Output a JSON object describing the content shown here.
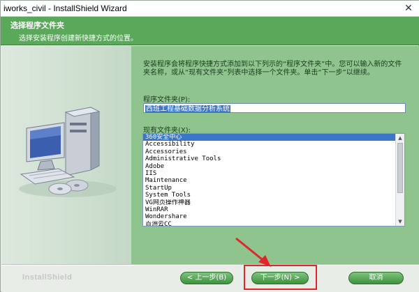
{
  "window": {
    "title": "iworks_civil - InstallShield Wizard",
    "close_glyph": "✕"
  },
  "header": {
    "title": "选择程序文件夹",
    "subtitle": "选择安装程序创建新快捷方式的位置。"
  },
  "main": {
    "intro": "安装程序会将程序快捷方式添加到以下列示的“程序文件夹”中。您可以输入新的文件夹名称，或从“现有文件夹”列表中选择一个文件夹。单击“下一步”以继续。",
    "program_folder_label": "程序文件夹(P):",
    "program_folder_value": "西班工程基础数据分析系统",
    "existing_folders_label": "现有文件夹(X):",
    "existing_folders": [
      "360安全中心",
      "Accessibility",
      "Accessories",
      "Administrative Tools",
      "Adobe",
      "IIS",
      "Maintenance",
      "StartUp",
      "System Tools",
      "VG网页操作神器",
      "WinRAR",
      "Wondershare",
      "百洲云CC"
    ],
    "selected_folder_index": 0
  },
  "footer": {
    "brand": "InstallShield",
    "back_label": "< 上一步(B)",
    "next_label": "下一步(N) >",
    "cancel_label": "取消"
  },
  "colors": {
    "header_bg": "#5aa95a",
    "panel_bg": "#8fc48f",
    "button_green": "#3f913f",
    "selection_blue": "#3b76c9",
    "annotation_red": "#e0262b"
  },
  "icons": {
    "close": "close-icon",
    "computer": "computer-illustration",
    "scroll_up": "scroll-up-icon",
    "scroll_down": "scroll-down-icon",
    "annotation_arrow": "red-arrow-annotation"
  }
}
